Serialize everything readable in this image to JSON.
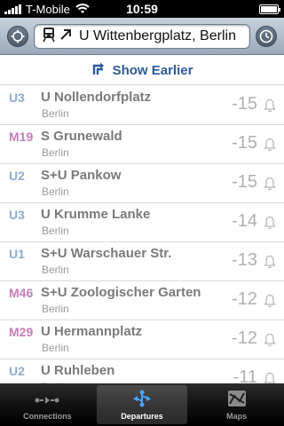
{
  "status_bar": {
    "carrier": "T-Mobile",
    "time": "10:59"
  },
  "toolbar": {
    "left_icon": "location-target-icon",
    "right_icon": "clock-icon",
    "station_field": {
      "icons": [
        "train-icon",
        "arrow-up-right-icon"
      ],
      "value": "U Wittenbergplatz, Berlin"
    }
  },
  "show_earlier": {
    "label": "Show Earlier",
    "icon": "show-earlier-arrow-icon",
    "color": "#2d5a9c"
  },
  "departures": [
    {
      "line": "U3",
      "line_color": "#8aaed0",
      "destination": "U Nollendorfplatz",
      "city": "Berlin",
      "minutes": "-15"
    },
    {
      "line": "M19",
      "line_color": "#c47cba",
      "destination": "S Grunewald",
      "city": "Berlin",
      "minutes": "-15"
    },
    {
      "line": "U2",
      "line_color": "#8aaed0",
      "destination": "S+U Pankow",
      "city": "Berlin",
      "minutes": "-15"
    },
    {
      "line": "U3",
      "line_color": "#8aaed0",
      "destination": "U Krumme Lanke",
      "city": "Berlin",
      "minutes": "-14"
    },
    {
      "line": "U1",
      "line_color": "#8aaed0",
      "destination": "S+U Warschauer Str.",
      "city": "Berlin",
      "minutes": "-13"
    },
    {
      "line": "M46",
      "line_color": "#c47cba",
      "destination": "S+U Zoologischer Garten",
      "city": "Berlin",
      "minutes": "-12"
    },
    {
      "line": "M29",
      "line_color": "#c47cba",
      "destination": "U Hermannplatz",
      "city": "Berlin",
      "minutes": "-12"
    },
    {
      "line": "U2",
      "line_color": "#8aaed0",
      "destination": "U Ruhleben",
      "city": "Berlin",
      "minutes": "-11"
    }
  ],
  "tab_bar": {
    "tabs": [
      {
        "label": "Connections",
        "icon": "connections-icon",
        "active": false
      },
      {
        "label": "Departures",
        "icon": "departures-icon",
        "active": true
      },
      {
        "label": "Maps",
        "icon": "maps-icon",
        "active": false
      }
    ]
  }
}
